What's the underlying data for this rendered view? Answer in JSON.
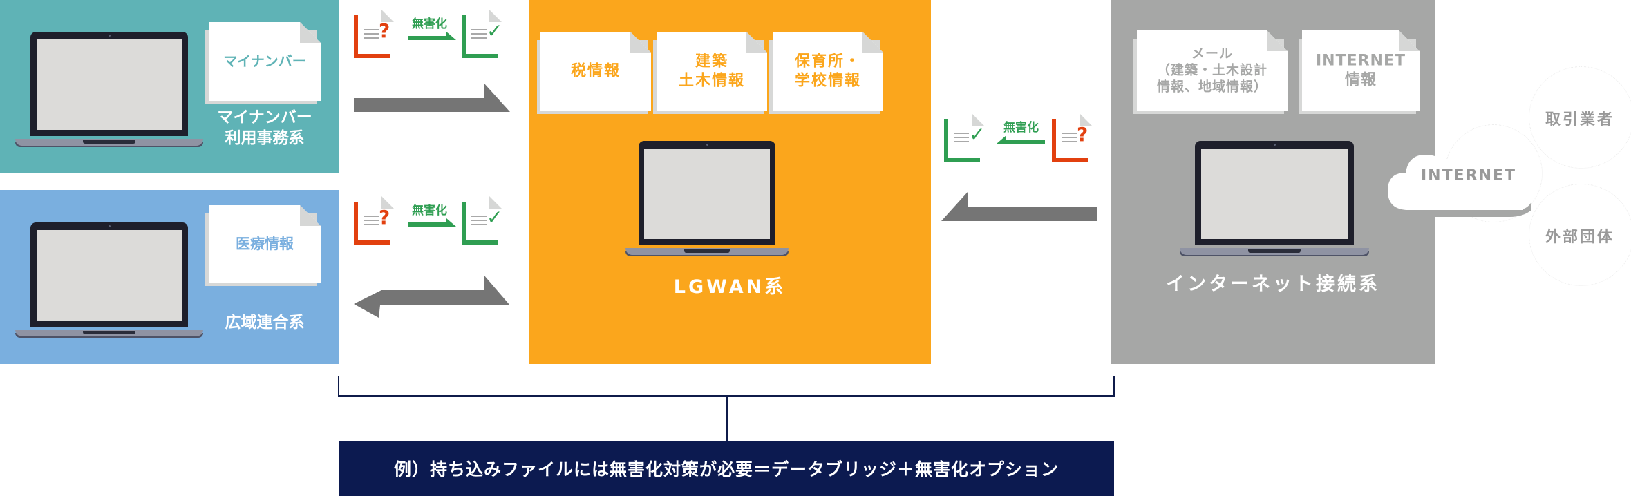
{
  "colors": {
    "mynumber_panel": "#5fb3b6",
    "regional_panel": "#7aafdf",
    "lgwan_panel": "#fba61c",
    "internet_panel": "#a6a7a6",
    "unsafe": "#e2400f",
    "safe": "#2f9e52",
    "transfer_arrow": "#757575",
    "note_bg": "#0c1a50"
  },
  "systems": {
    "mynumber": {
      "label": "マイナンバー\n利用事務系",
      "documents": [
        {
          "label": "マイナンバー"
        }
      ]
    },
    "regional": {
      "label": "広域連合系",
      "documents": [
        {
          "label": "医療情報"
        }
      ]
    },
    "lgwan": {
      "label": "LGWAN系",
      "documents": [
        {
          "label": "税情報"
        },
        {
          "label": "建築\n土木情報"
        },
        {
          "label": "保育所・\n学校情報"
        }
      ]
    },
    "internet": {
      "label": "インターネット接続系",
      "documents": [
        {
          "label": "メール\n（建築・土木設計\n情報、地域情報）"
        },
        {
          "label": "INTERNET\n情報"
        }
      ]
    }
  },
  "sanitize": {
    "label": "無害化",
    "unsafe_mark": "?",
    "safe_mark": "✓"
  },
  "external": {
    "cloud_label": "INTERNET",
    "parties": [
      "取引業者",
      "外部団体"
    ]
  },
  "note": {
    "text": "例）持ち込みファイルには無害化対策が必要＝データブリッジ＋無害化オプション"
  }
}
